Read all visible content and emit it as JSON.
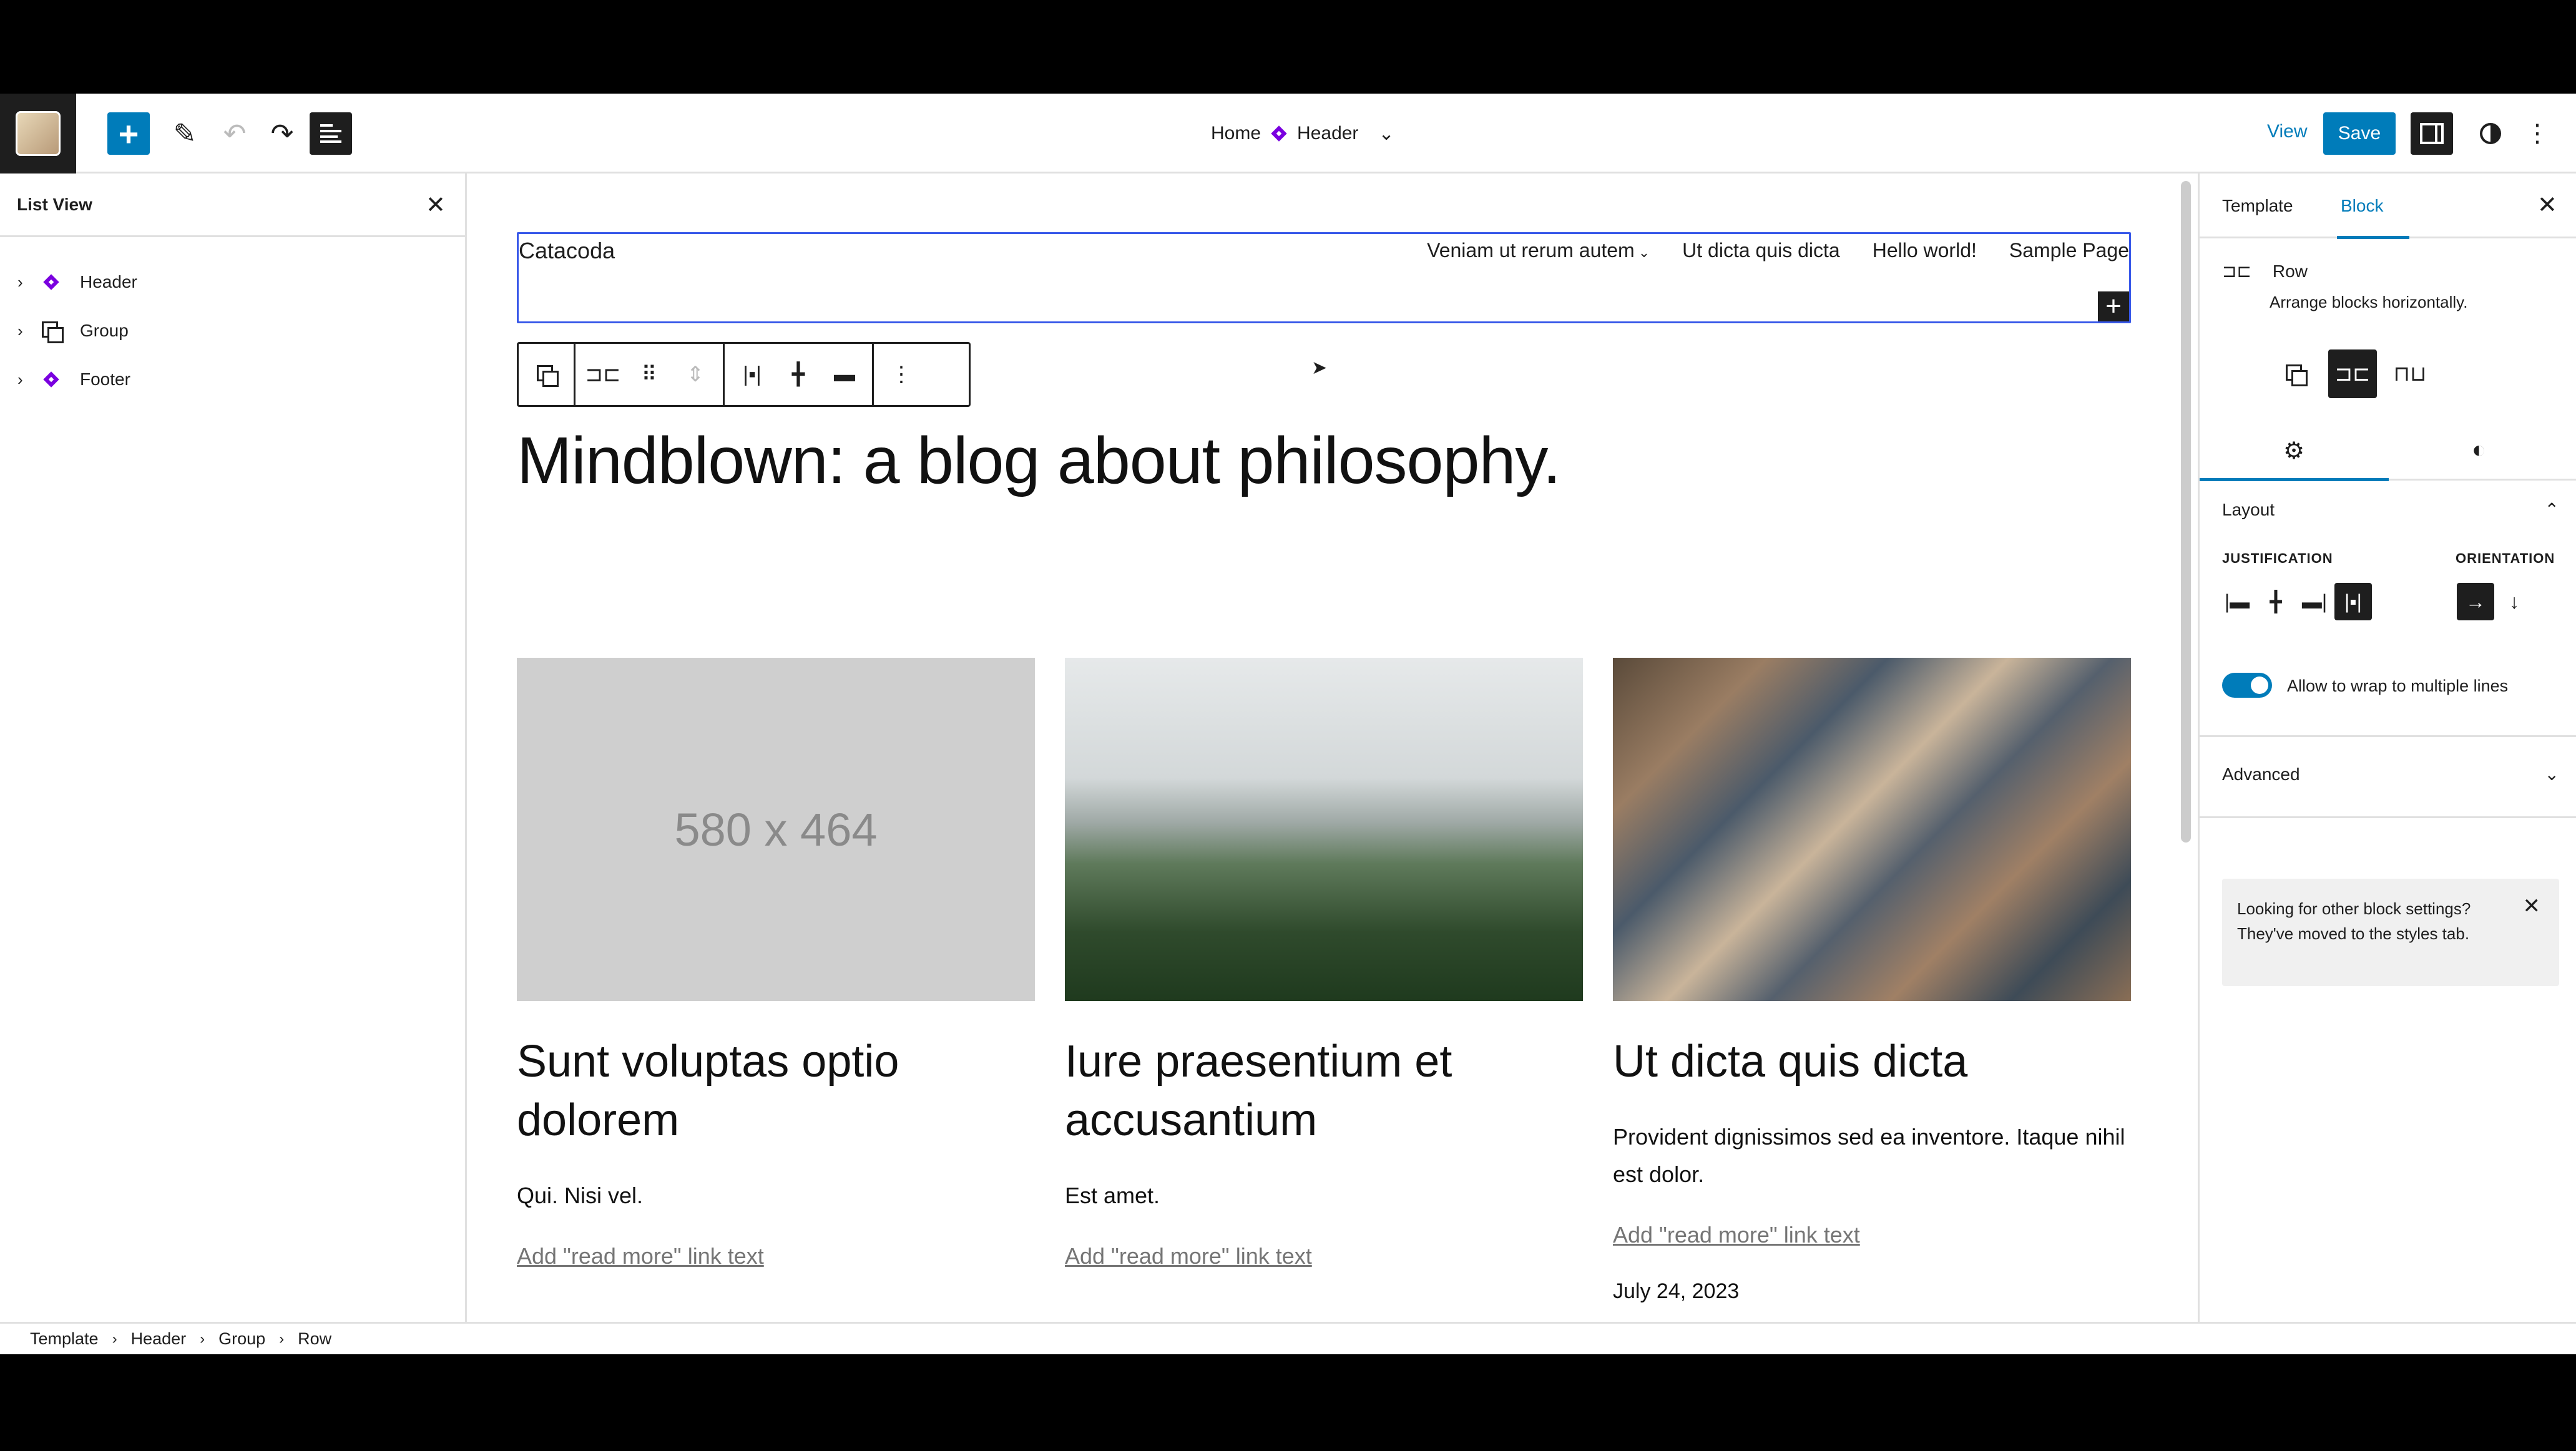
{
  "topbar": {
    "breadcrumb_home": "Home",
    "document_title": "Header",
    "view_label": "View",
    "save_label": "Save"
  },
  "list_view": {
    "title": "List View",
    "items": [
      {
        "label": "Header",
        "icon": "template-part-icon"
      },
      {
        "label": "Group",
        "icon": "group-icon"
      },
      {
        "label": "Footer",
        "icon": "template-part-icon"
      }
    ]
  },
  "canvas": {
    "site_title": "Catacoda",
    "nav": [
      "Veniam ut rerum autem",
      "Ut dicta quis dicta",
      "Hello world!",
      "Sample Page"
    ],
    "blog_title": "Mindblown: a blog about philosophy.",
    "posts": [
      {
        "image": "580 x 464",
        "title": "Sunt voluptas optio dolorem",
        "excerpt": "Qui. Nisi vel.",
        "read_more": "Add \"read more\" link text",
        "date": ""
      },
      {
        "image": "",
        "title": "Iure praesentium et accusantium",
        "excerpt": "Est amet.",
        "read_more": "Add \"read more\" link text",
        "date": ""
      },
      {
        "image": "",
        "title": "Ut dicta quis dicta",
        "excerpt": "Provident dignissimos sed ea inventore. Itaque nihil est dolor.",
        "read_more": "Add \"read more\" link text",
        "date": "July 24, 2023"
      }
    ]
  },
  "settings": {
    "tabs": [
      "Template",
      "Block"
    ],
    "active_tab": "Block",
    "block_name": "Row",
    "block_description": "Arrange blocks horizontally.",
    "layout_title": "Layout",
    "justification_label": "JUSTIFICATION",
    "orientation_label": "ORIENTATION",
    "wrap_label": "Allow to wrap to multiple lines",
    "wrap_enabled": true,
    "advanced_title": "Advanced",
    "notice": "Looking for other block settings? They've moved to the styles tab."
  },
  "footer_breadcrumb": [
    "Template",
    "Header",
    "Group",
    "Row"
  ],
  "colors": {
    "accent": "#007cba",
    "template_part": "#7a00df",
    "selection": "#3858e9"
  }
}
